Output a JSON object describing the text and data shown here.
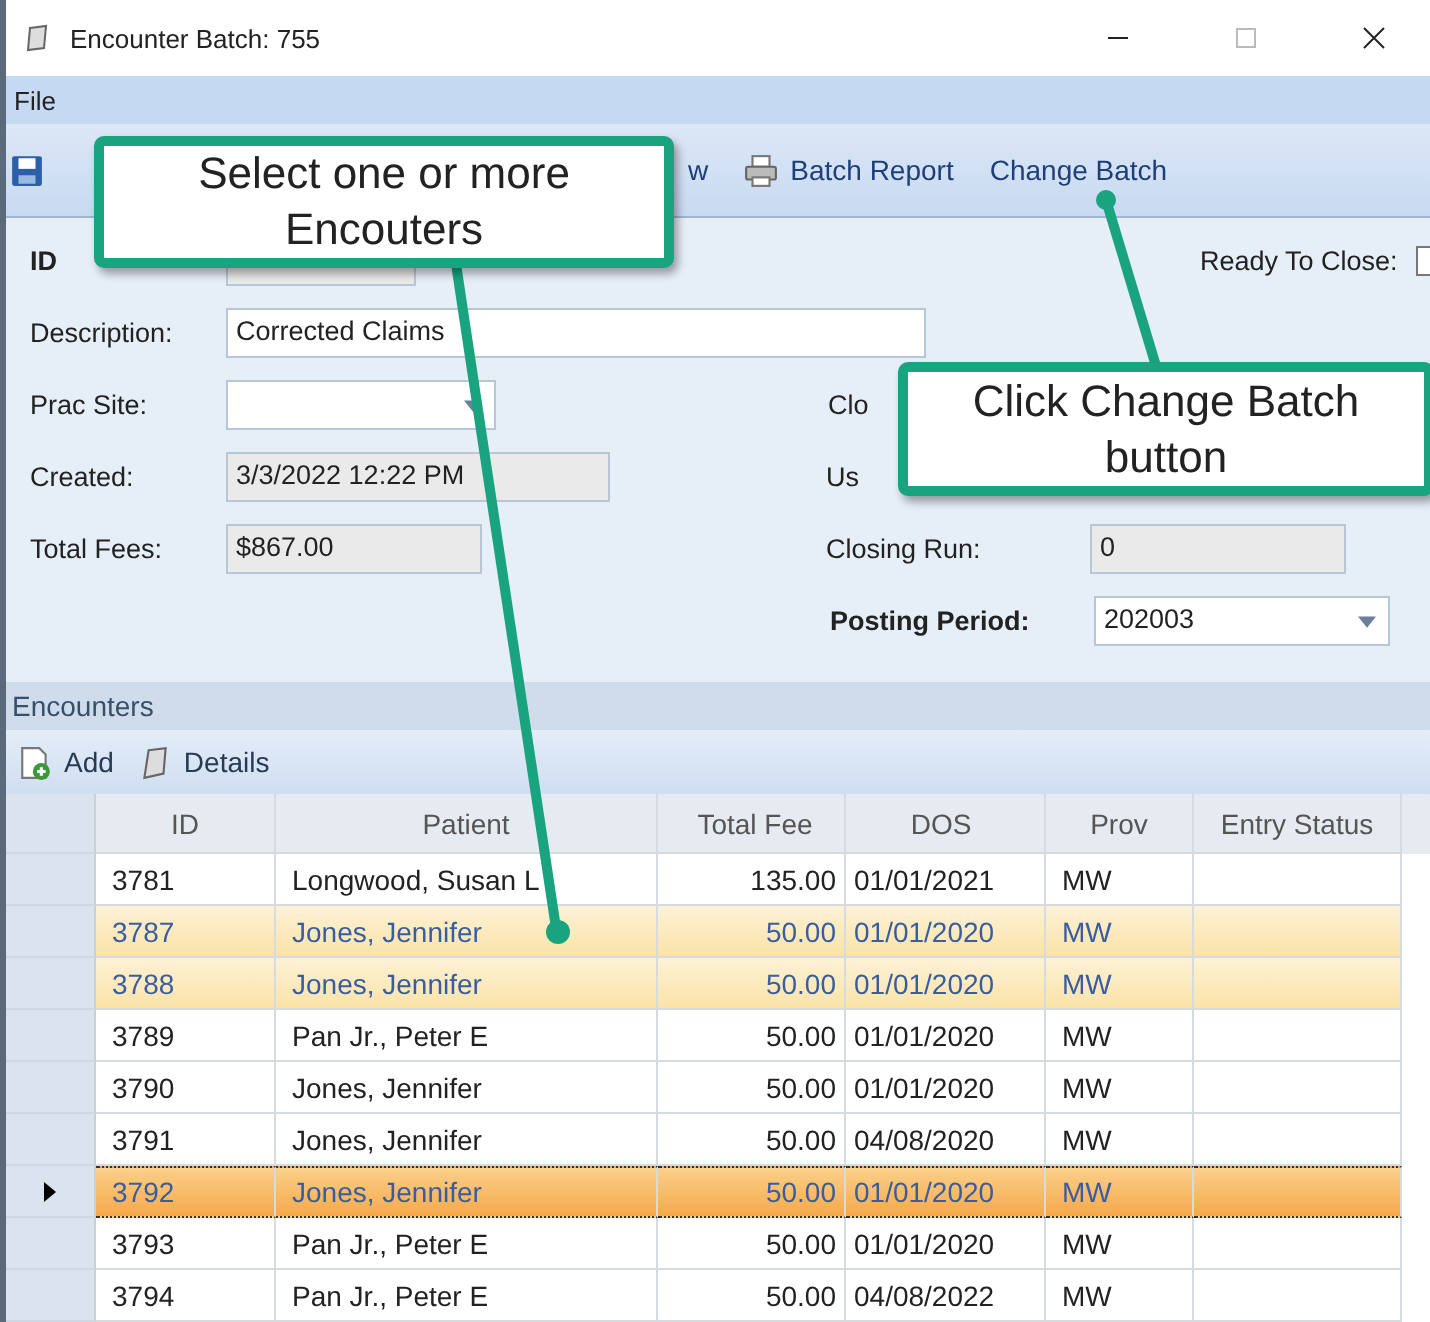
{
  "window": {
    "title": "Encounter Batch: 755"
  },
  "menu": [
    "File"
  ],
  "toolbar": [
    {
      "kind": "save"
    },
    {
      "kind": "partial",
      "label": "w"
    },
    {
      "kind": "print",
      "label": "Batch Report"
    },
    {
      "kind": "plain",
      "label": "Change Batch"
    }
  ],
  "form": {
    "id_label": "ID",
    "ready_label": "Ready To Close:",
    "ready_checked": false,
    "description_label": "Description:",
    "description": "Corrected Claims",
    "prac_site_label": "Prac Site:",
    "closing_label_partial": "Clo",
    "created_label": "Created:",
    "created": "3/3/2022 12:22 PM",
    "user_label_partial": "Us",
    "total_fees_label": "Total Fees:",
    "total_fees": "$867.00",
    "closing_run_label": "Closing Run:",
    "closing_run": "0",
    "posting_period_label": "Posting Period:",
    "posting_period": "202003"
  },
  "encounters": {
    "title": "Encounters",
    "actions": [
      {
        "kind": "add",
        "label": "Add"
      },
      {
        "kind": "details",
        "label": "Details"
      }
    ],
    "columns": [
      "ID",
      "Patient",
      "Total Fee",
      "DOS",
      "Prov",
      "Entry Status"
    ],
    "rows": [
      {
        "cells": [
          "3781",
          "Longwood, Susan L",
          "135.00",
          "01/01/2021",
          "MW",
          ""
        ],
        "selected": false,
        "current": false
      },
      {
        "cells": [
          "3787",
          "Jones, Jennifer",
          "50.00",
          "01/01/2020",
          "MW",
          ""
        ],
        "selected": true,
        "current": false
      },
      {
        "cells": [
          "3788",
          "Jones, Jennifer",
          "50.00",
          "01/01/2020",
          "MW",
          ""
        ],
        "selected": true,
        "current": false
      },
      {
        "cells": [
          "3789",
          "Pan Jr., Peter E",
          "50.00",
          "01/01/2020",
          "MW",
          ""
        ],
        "selected": false,
        "current": false
      },
      {
        "cells": [
          "3790",
          "Jones, Jennifer",
          "50.00",
          "01/01/2020",
          "MW",
          ""
        ],
        "selected": false,
        "current": false
      },
      {
        "cells": [
          "3791",
          "Jones, Jennifer",
          "50.00",
          "04/08/2020",
          "MW",
          ""
        ],
        "selected": false,
        "current": false
      },
      {
        "cells": [
          "3792",
          "Jones, Jennifer",
          "50.00",
          "01/01/2020",
          "MW",
          ""
        ],
        "selected": true,
        "current": true
      },
      {
        "cells": [
          "3793",
          "Pan Jr., Peter E",
          "50.00",
          "01/01/2020",
          "MW",
          ""
        ],
        "selected": false,
        "current": false
      },
      {
        "cells": [
          "3794",
          "Pan Jr., Peter E",
          "50.00",
          "04/08/2022",
          "MW",
          ""
        ],
        "selected": false,
        "current": false
      }
    ]
  },
  "callouts": [
    {
      "text": "Select one or more Encouters"
    },
    {
      "text": "Click Change Batch button"
    }
  ]
}
